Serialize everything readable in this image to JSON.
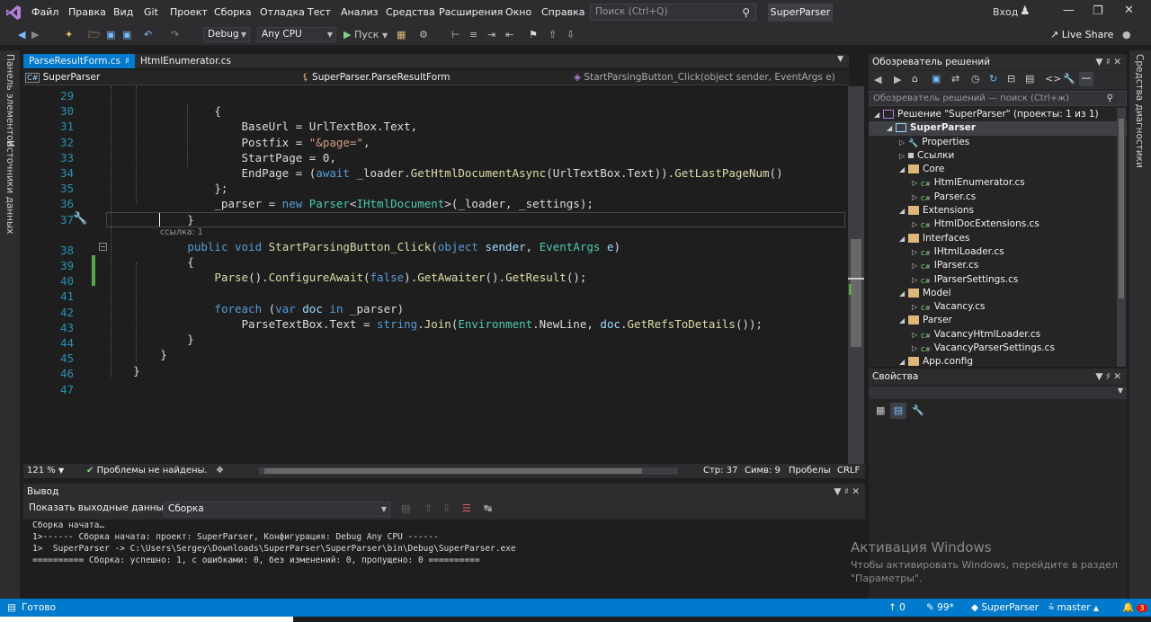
{
  "menu": {
    "items": [
      "Файл",
      "Правка",
      "Вид",
      "Git",
      "Проект",
      "Сборка",
      "Отладка",
      "Тест",
      "Анализ",
      "Средства",
      "Расширения",
      "Окно",
      "Справка"
    ],
    "search_placeholder": "Поиск (Ctrl+Q)",
    "solution_name": "SuperParser",
    "login": "Вход"
  },
  "toolbar": {
    "config": "Debug",
    "platform": "Any CPU",
    "run": "Пуск",
    "live_share": "Live Share"
  },
  "left_tabs": [
    "Панель элементов",
    "Источники данных"
  ],
  "right_tabs": [
    "Средства диагностики"
  ],
  "doc_tabs": [
    "ParseResultForm.cs",
    "HtmlEnumerator.cs"
  ],
  "nav": {
    "project": "SuperParser",
    "class": "SuperParser.ParseResultForm",
    "member": "StartParsingButton_Click(object sender, EventArgs e)"
  },
  "editor": {
    "line_numbers": [
      "29",
      "30",
      "31",
      "32",
      "33",
      "34",
      "35",
      "36",
      "37",
      "38",
      "39",
      "40",
      "41",
      "42",
      "43",
      "44",
      "45",
      "46",
      "47"
    ],
    "codelens": "ссылка: 1"
  },
  "editor_status": {
    "zoom": "121 %",
    "issues": "Проблемы не найдены.",
    "line": "Стр: 37",
    "column": "Симв: 9",
    "whitespace": "Пробелы",
    "line_ending": "CRLF"
  },
  "solution_explorer": {
    "title": "Обозреватель решений",
    "search_placeholder": "Обозреватель решений — поиск (Ctrl+ж)",
    "nodes": [
      {
        "label": "Решение \"SuperParser\" (проекты: 1 из 1)",
        "indent": 0
      },
      {
        "label": "SuperParser",
        "indent": 1,
        "selected": true
      },
      {
        "label": "Properties",
        "indent": 2
      },
      {
        "label": "Ссылки",
        "indent": 2
      },
      {
        "label": "Core",
        "indent": 2
      },
      {
        "label": "HtmlEnumerator.cs",
        "indent": 3
      },
      {
        "label": "Parser.cs",
        "indent": 3
      },
      {
        "label": "Extensions",
        "indent": 2
      },
      {
        "label": "HtmlDocExtensions.cs",
        "indent": 3
      },
      {
        "label": "Interfaces",
        "indent": 2
      },
      {
        "label": "IHtmlLoader.cs",
        "indent": 3
      },
      {
        "label": "IParser.cs",
        "indent": 3
      },
      {
        "label": "IParserSettings.cs",
        "indent": 3
      },
      {
        "label": "Model",
        "indent": 2
      },
      {
        "label": "Vacancy.cs",
        "indent": 3
      },
      {
        "label": "Parser",
        "indent": 2
      },
      {
        "label": "VacancyHtmlLoader.cs",
        "indent": 3
      },
      {
        "label": "VacancyParserSettings.cs",
        "indent": 3
      },
      {
        "label": "App.config",
        "indent": 2
      }
    ]
  },
  "properties": {
    "title": "Свойства"
  },
  "output": {
    "title": "Вывод",
    "source_label": "Показать выходные данные из:",
    "source_value": "Сборка",
    "lines": [
      "Сборка начата…",
      "1>------ Сборка начата: проект: SuperParser, Конфигурация: Debug Any CPU ------",
      "1>  SuperParser -> C:\\Users\\Sergey\\Downloads\\SuperParser\\SuperParser\\bin\\Debug\\SuperParser.exe",
      "========== Сборка: успешно: 1, с ошибками: 0, без изменений: 0, пропущено: 0 =========="
    ]
  },
  "activation": {
    "title": "Активация Windows",
    "line1": "Чтобы активировать Windows, перейдите в раздел",
    "line2": "\"Параметры\"."
  },
  "statusbar": {
    "ready": "Готово",
    "up": "0",
    "pencil": "99*",
    "repo": "SuperParser",
    "branch": "master",
    "notif": "3"
  },
  "colors": {
    "accent": "#007acc",
    "keyword": "#569cd6",
    "type": "#4ec9b0",
    "method": "#dcdcaa",
    "string": "#d69d85"
  }
}
